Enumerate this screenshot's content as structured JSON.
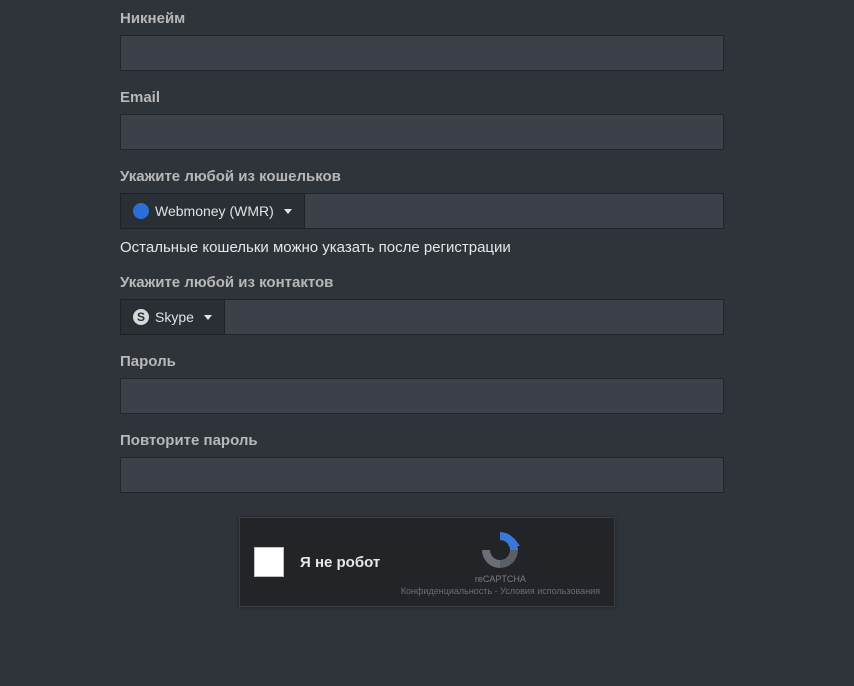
{
  "fields": {
    "nickname": {
      "label": "Никнейм",
      "value": ""
    },
    "email": {
      "label": "Email",
      "value": ""
    },
    "wallet": {
      "label": "Укажите любой из кошельков",
      "selected": "Webmoney (WMR)",
      "value": "",
      "hint": "Остальные кошельки можно указать после регистрации"
    },
    "contact": {
      "label": "Укажите любой из контактов",
      "selected": "Skype",
      "value": ""
    },
    "password": {
      "label": "Пароль",
      "value": ""
    },
    "password_repeat": {
      "label": "Повторите пароль",
      "value": ""
    }
  },
  "recaptcha": {
    "label": "Я не робот",
    "brand": "reCAPTCHA",
    "links": "Конфиденциальность - Условия использования"
  }
}
